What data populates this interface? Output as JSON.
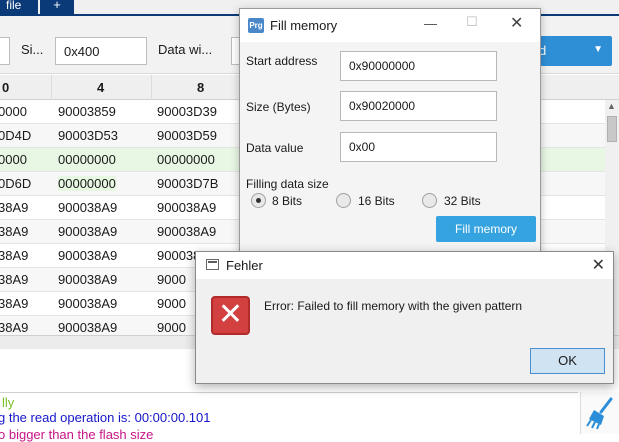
{
  "tabs": {
    "file_label": "file",
    "add_label": "+"
  },
  "toolbar": {
    "size_label": "Si...",
    "size_value": "0x400",
    "width_label": "Data wi...",
    "action_label": "d"
  },
  "memory_grid": {
    "headers": [
      "0",
      "4",
      "8"
    ],
    "rows": [
      [
        "0000",
        "90003859",
        "90003D39"
      ],
      [
        "0D4D",
        "90003D53",
        "90003D59"
      ],
      [
        "0000",
        "00000000",
        "00000000"
      ],
      [
        "0D6D",
        "00000000",
        "90003D7B"
      ],
      [
        "38A9",
        "900038A9",
        "900038A9"
      ],
      [
        "38A9",
        "900038A9",
        "900038A9"
      ],
      [
        "38A9",
        "900038A9",
        "900038A9"
      ],
      [
        "38A9",
        "900038A9",
        "9000"
      ],
      [
        "38A9",
        "900038A9",
        "9000"
      ],
      [
        "38A9",
        "900038A9",
        "9000"
      ]
    ]
  },
  "log": {
    "line1": "lly",
    "line2": "g the read operation is: 00:00:00.101",
    "line3": "o bigger than the flash size"
  },
  "fill_dialog": {
    "app_icon_text": "Prg",
    "title": "Fill memory",
    "start_address_label": "Start address",
    "start_address_value": "0x90000000",
    "size_label": "Size (Bytes)",
    "size_value": "0x90020000",
    "data_value_label": "Data value",
    "data_value_value": "0x00",
    "filling_size_label": "Filling data size",
    "options": [
      "8 Bits",
      "16 Bits",
      "32 Bits"
    ],
    "selected_option": "8 Bits",
    "fill_button": "Fill memory"
  },
  "error_dialog": {
    "title": "Fehler",
    "message": "Error: Failed to fill memory with the given pattern",
    "ok_button": "OK",
    "icon_glyph": "✕"
  }
}
